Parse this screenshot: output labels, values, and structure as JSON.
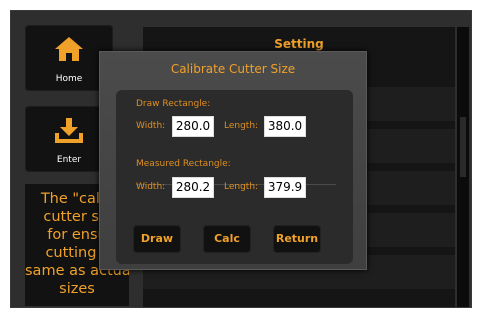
{
  "nav": {
    "home_label": "Home",
    "enter_label": "Enter",
    "home_icon": "home-icon",
    "enter_icon": "download-icon",
    "accent": "#f0a12a"
  },
  "info_text": "The \"calib\ncutter siz\nfor ensu\ncutting s\nsame as actual\nsizes",
  "panel": {
    "title": "Setting"
  },
  "dialog": {
    "title": "Calibrate Cutter Size",
    "draw_section": "Draw Rectangle:",
    "measured_section": "Measured Rectangle:",
    "width_label": "Width:",
    "length_label": "Length:",
    "draw_width": "280.0",
    "draw_length": "380.0",
    "measured_width": "280.2",
    "measured_length": "379.9",
    "buttons": {
      "draw": "Draw",
      "calc": "Calc",
      "return": "Return"
    }
  }
}
